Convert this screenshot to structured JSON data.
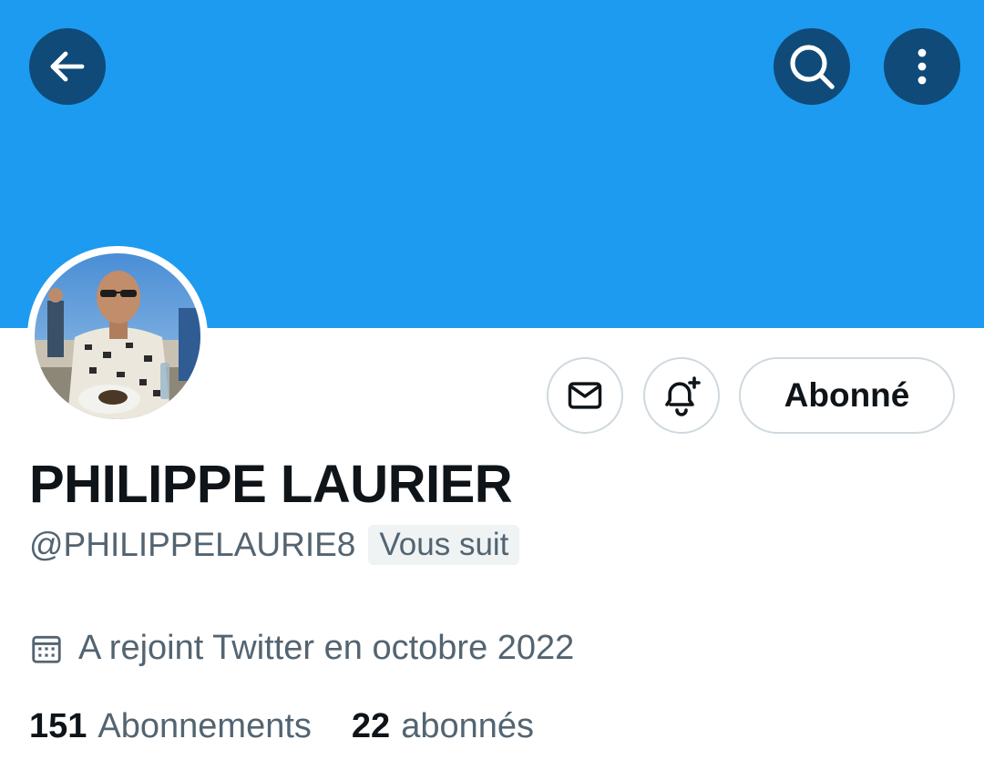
{
  "header": {
    "back_icon": "arrow-left-icon",
    "search_icon": "search-icon",
    "more_icon": "more-vertical-icon",
    "banner_color": "#1d9bf0",
    "button_color": "#0f4a78"
  },
  "actions": {
    "message_icon": "envelope-icon",
    "notify_icon": "bell-plus-icon",
    "follow_label": "Abonné"
  },
  "profile": {
    "name": "PHILIPPE LAURIER",
    "handle": "@PHILIPPELAURIE8",
    "follows_you": "Vous suit",
    "joined": "A rejoint Twitter en octobre 2022",
    "joined_icon": "calendar-icon"
  },
  "stats": {
    "following_count": "151",
    "following_label": "Abonnements",
    "followers_count": "22",
    "followers_label": "abonnés"
  }
}
